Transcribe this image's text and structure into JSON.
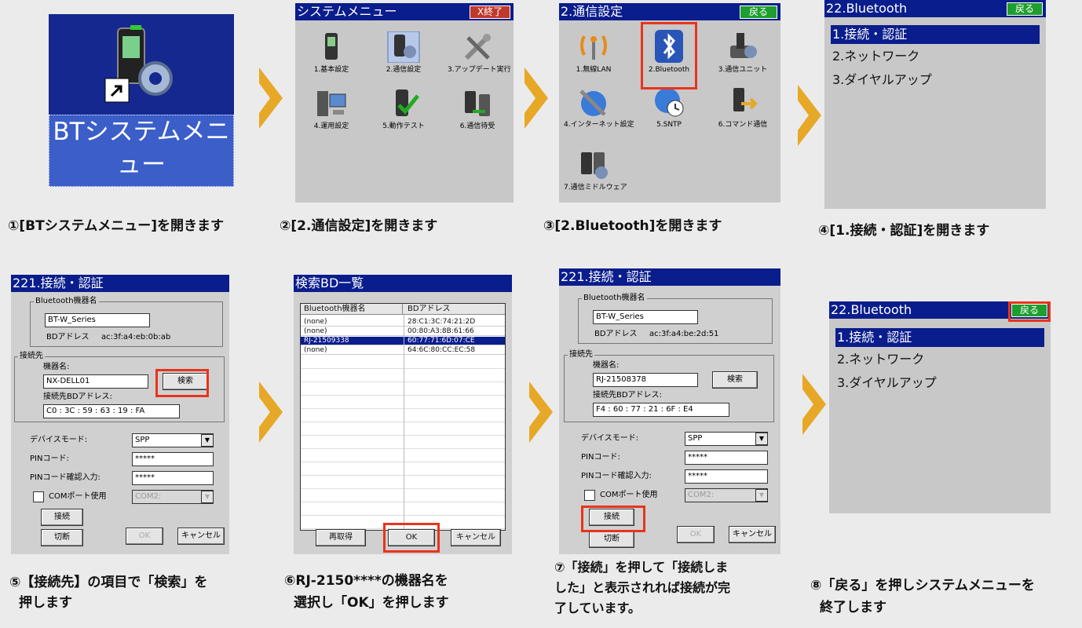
{
  "step1": {
    "label_line1": "BTシステムメニ",
    "label_line2": "ュー",
    "caption": "①[BTシステムメニュー]を開きます",
    "colors": {
      "bg": "#15288f",
      "label_bg": "#3b5ec8"
    }
  },
  "step2": {
    "title": "システムメニュー",
    "close_label": "X終了",
    "items": [
      "1.基本設定",
      "2.通信設定",
      "3.アップデート実行",
      "4.運用設定",
      "5.動作テスト",
      "6.通信待受"
    ],
    "caption": "②[2.通信設定]を開きます"
  },
  "step3": {
    "title": "2.通信設定",
    "back_label": "戻る",
    "items": [
      "1.無線LAN",
      "2.Bluetooth",
      "3.通信ユニット",
      "4.インターネット設定",
      "5.SNTP",
      "6.コマンド通信",
      "7.通信ミドルウェア"
    ],
    "caption": "③[2.Bluetooth]を開きます"
  },
  "step4": {
    "title": "22.Bluetooth",
    "back_label": "戻る",
    "items": [
      "1.接続・認証",
      "2.ネットワーク",
      "3.ダイヤルアップ"
    ],
    "caption": "④[1.接続・認証]を開きます"
  },
  "step5": {
    "title": "221.接続・認証",
    "group_bt": "Bluetooth機器名",
    "bt_name": "BT-W_Series",
    "bd_label": "BDアドレス",
    "bd_value": "ac:3f:a4:eb:0b:ab",
    "group_dest": "接続先",
    "dev_name_label": "機器名:",
    "dev_name": "NX-DELL01",
    "search_label": "検索",
    "dest_bd_label": "接続先BDアドレス:",
    "dest_bd": "C0 : 3C : 59 : 63 : 19 : FA",
    "device_mode_label": "デバイスモード:",
    "device_mode": "SPP",
    "pin_label": "PINコード:",
    "pin": "*****",
    "pin_confirm_label": "PINコード確認入力:",
    "pin_confirm": "*****",
    "com_label": "COMポート使用",
    "com_value": "COM2:",
    "connect_label": "接続",
    "disconnect_label": "切断",
    "ok_label": "OK",
    "cancel_label": "キャンセル",
    "caption_line1": "⑤【接続先】の項目で「検索」を",
    "caption_line2": "押します"
  },
  "step6": {
    "title": "検索BD一覧",
    "col_name": "Bluetooth機器名",
    "col_addr": "BDアドレス",
    "rows": [
      {
        "name": "(none)",
        "addr": "28:C1:3C:74:21:2D"
      },
      {
        "name": "(none)",
        "addr": "00:80:A3:8B:61:66"
      },
      {
        "name": "RJ-21509338",
        "addr": "60:77:71:6D:07:CE"
      },
      {
        "name": "(none)",
        "addr": "64:6C:80:CC:EC:58"
      }
    ],
    "reload_label": "再取得",
    "ok_label": "OK",
    "cancel_label": "キャンセル",
    "caption_line1": "⑥RJ-2150****の機器名を",
    "caption_line2": "選択し「OK」を押します"
  },
  "step7": {
    "title": "221.接続・認証",
    "group_bt": "Bluetooth機器名",
    "bt_name": "BT-W_Series",
    "bd_label": "BDアドレス",
    "bd_value": "ac:3f:a4:be:2d:51",
    "group_dest": "接続先",
    "dev_name_label": "機器名:",
    "dev_name": "RJ-21508378",
    "search_label": "検索",
    "dest_bd_label": "接続先BDアドレス:",
    "dest_bd": "F4 : 60 : 77 : 21 : 6F : E4",
    "device_mode_label": "デバイスモード:",
    "device_mode": "SPP",
    "pin_label": "PINコード:",
    "pin": "*****",
    "pin_confirm_label": "PINコード確認入力:",
    "pin_confirm": "*****",
    "com_label": "COMポート使用",
    "com_value": "COM2:",
    "connect_label": "接続",
    "disconnect_label": "切断",
    "ok_label": "OK",
    "cancel_label": "キャンセル",
    "caption_line1": "⑦「接続」を押して「接続しま",
    "caption_line2": "した」と表示されれば接続が完",
    "caption_line3": "了しています。"
  },
  "step8": {
    "title": "22.Bluetooth",
    "back_label": "戻る",
    "items": [
      "1.接続・認証",
      "2.ネットワーク",
      "3.ダイヤルアップ"
    ],
    "caption_line1": "⑧「戻る」を押しシステムメニューを",
    "caption_line2": "終了します"
  },
  "colors": {
    "arrow": "#e6a826",
    "title_bar": "#0a1d8c",
    "highlight": "#e8341c"
  }
}
